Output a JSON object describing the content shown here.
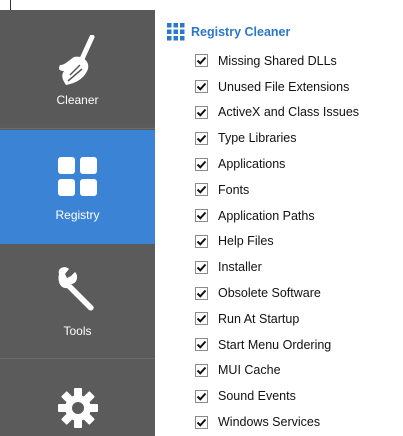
{
  "sidebar": {
    "items": [
      {
        "label": "Cleaner",
        "icon": "broom-icon",
        "selected": false
      },
      {
        "label": "Registry",
        "icon": "grid-icon",
        "selected": true
      },
      {
        "label": "Tools",
        "icon": "wrench-icon",
        "selected": false
      },
      {
        "label": "",
        "icon": "gear-icon",
        "selected": false
      }
    ]
  },
  "colors": {
    "sidebar_bg": "#5b5b5b",
    "sidebar_selected": "#3b83d4",
    "accent": "#2b78c9"
  },
  "main": {
    "section_title": "Registry Cleaner",
    "section_icon": "grid-icon",
    "items": [
      {
        "label": "Missing Shared DLLs",
        "checked": true
      },
      {
        "label": "Unused File Extensions",
        "checked": true
      },
      {
        "label": "ActiveX and Class Issues",
        "checked": true
      },
      {
        "label": "Type Libraries",
        "checked": true
      },
      {
        "label": "Applications",
        "checked": true
      },
      {
        "label": "Fonts",
        "checked": true
      },
      {
        "label": "Application Paths",
        "checked": true
      },
      {
        "label": "Help Files",
        "checked": true
      },
      {
        "label": "Installer",
        "checked": true
      },
      {
        "label": "Obsolete Software",
        "checked": true
      },
      {
        "label": "Run At Startup",
        "checked": true
      },
      {
        "label": "Start Menu Ordering",
        "checked": true
      },
      {
        "label": "MUI Cache",
        "checked": true
      },
      {
        "label": "Sound Events",
        "checked": true
      },
      {
        "label": "Windows Services",
        "checked": true
      }
    ]
  }
}
